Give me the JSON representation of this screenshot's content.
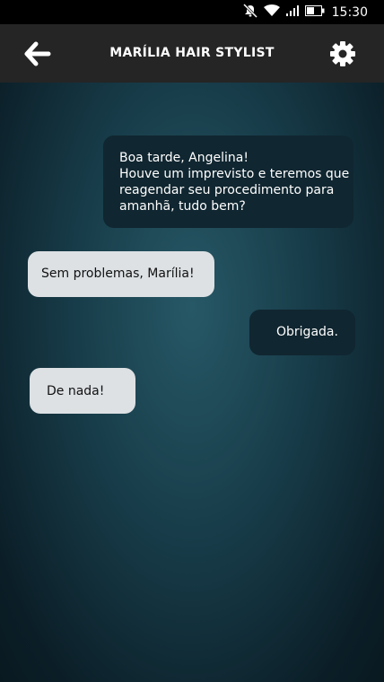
{
  "status_bar": {
    "time": "15:30",
    "icons": [
      "notifications-muted-icon",
      "wifi-icon",
      "signal-icon",
      "battery-icon"
    ]
  },
  "header": {
    "title": "MARÍLIA HAIR STYLIST",
    "back_icon": "arrow-left-icon",
    "settings_icon": "gear-icon"
  },
  "messages": [
    {
      "direction": "sent",
      "lines": [
        "Boa tarde, Angelina!",
        "Houve um imprevisto e teremos que",
        "reagendar seu procedimento para",
        "amanhã, tudo bem?"
      ]
    },
    {
      "direction": "received",
      "lines": [
        "Sem problemas, Marília!"
      ]
    },
    {
      "direction": "sent",
      "lines": [
        "Obrigada."
      ]
    },
    {
      "direction": "received",
      "lines": [
        "De nada!"
      ]
    }
  ],
  "colors": {
    "status_bar": "#000000",
    "header": "#252525",
    "sent_bubble": "#102630",
    "received_bubble": "#dde1e4",
    "background_center": "#275866",
    "background_edge": "#091920"
  }
}
